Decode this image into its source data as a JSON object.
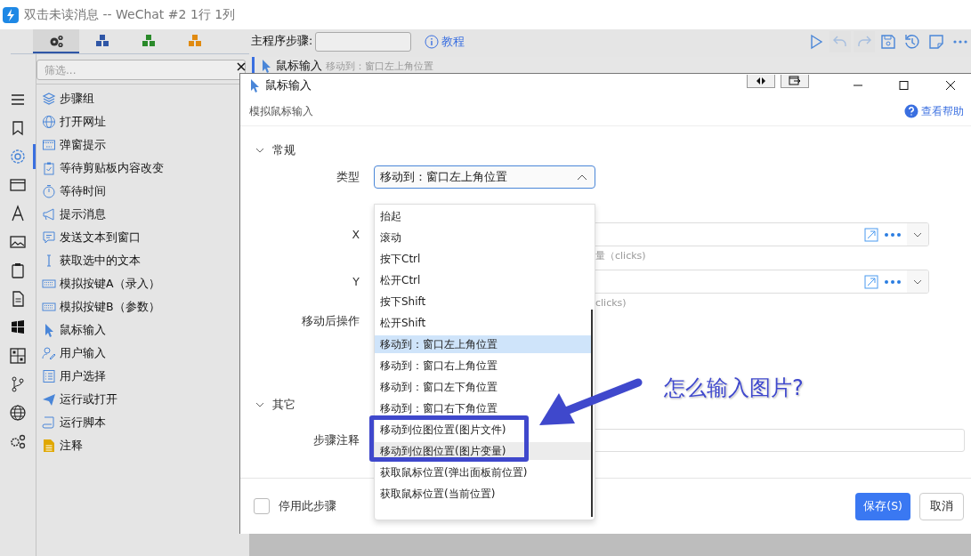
{
  "window": {
    "title": "双击未读消息 -- WeChat #2 1行 1列"
  },
  "palette_tabs": [
    {
      "selected": true,
      "color": "#333333"
    },
    {
      "selected": false,
      "color": "#2f56a6"
    },
    {
      "selected": false,
      "color": "#2a8a2a"
    },
    {
      "selected": false,
      "color": "#e08a10"
    }
  ],
  "filter": {
    "placeholder": "筛选..."
  },
  "rail": [
    {
      "kind": "menu",
      "selected": false
    },
    {
      "kind": "bookmark",
      "selected": false
    },
    {
      "kind": "gear",
      "selected": true
    },
    {
      "kind": "window",
      "selected": false
    },
    {
      "kind": "font",
      "selected": false
    },
    {
      "kind": "image",
      "selected": false
    },
    {
      "kind": "clipboard",
      "selected": false
    },
    {
      "kind": "document",
      "selected": false
    },
    {
      "kind": "panes",
      "selected": false
    },
    {
      "kind": "grid",
      "selected": false
    },
    {
      "kind": "branch",
      "selected": false
    },
    {
      "kind": "globe",
      "selected": false
    },
    {
      "kind": "gears",
      "selected": false
    }
  ],
  "actions": [
    {
      "label": "步骤组",
      "kind": "layers"
    },
    {
      "label": "打开网址",
      "kind": "globe"
    },
    {
      "label": "弹窗提示",
      "kind": "popup"
    },
    {
      "label": "等待剪贴板内容改变",
      "kind": "clipboard"
    },
    {
      "label": "等待时间",
      "kind": "stopwatch"
    },
    {
      "label": "提示消息",
      "kind": "megaphone"
    },
    {
      "label": "发送文本到窗口",
      "kind": "chat"
    },
    {
      "label": "获取选中的文本",
      "kind": "cursor"
    },
    {
      "label": "模拟按键A（录入）",
      "kind": "keyboard"
    },
    {
      "label": "模拟按键B（参数）",
      "kind": "keyboard"
    },
    {
      "label": "鼠标输入",
      "kind": "pointer"
    },
    {
      "label": "用户输入",
      "kind": "user"
    },
    {
      "label": "用户选择",
      "kind": "list"
    },
    {
      "label": "运行或打开",
      "kind": "plane"
    },
    {
      "label": "运行脚本",
      "kind": "scroll"
    },
    {
      "label": "注释",
      "kind": "note"
    }
  ],
  "toolbar": {
    "label": "主程序步骤:",
    "tutorial": "教程",
    "buttons": [
      {
        "kind": "run",
        "disabled": false
      },
      {
        "kind": "undo",
        "disabled": true
      },
      {
        "kind": "redo",
        "disabled": true
      },
      {
        "kind": "save",
        "disabled": false
      },
      {
        "kind": "history",
        "disabled": false
      },
      {
        "kind": "note",
        "disabled": false
      },
      {
        "kind": "more",
        "disabled": false
      }
    ]
  },
  "step": {
    "title": "鼠标输入",
    "detail": "移动到：窗口左上角位置"
  },
  "dialog": {
    "title": "鼠标输入",
    "subtitle": "模拟鼠标输入",
    "help": "查看帮助",
    "general": {
      "title": "常规",
      "expanded": true,
      "type_label": "类型",
      "type_value": "移动到：窗口左上角位置",
      "x_label": "X",
      "x_hint": "量（clicks)",
      "y_label": "Y",
      "y_hint": "clicks)",
      "after_label": "移动后操作"
    },
    "other": {
      "title": "其它",
      "expanded": true,
      "note_label": "步骤注释"
    },
    "disable_step": {
      "label": "停用此步骤",
      "checked": false
    },
    "save": "保存(S)",
    "cancel": "取消"
  },
  "dropdown": [
    {
      "label": "抬起",
      "selected": false,
      "highlighted": false
    },
    {
      "label": "滚动",
      "selected": false,
      "highlighted": false
    },
    {
      "label": "按下Ctrl",
      "selected": false,
      "highlighted": false
    },
    {
      "label": "松开Ctrl",
      "selected": false,
      "highlighted": false
    },
    {
      "label": "按下Shift",
      "selected": false,
      "highlighted": false
    },
    {
      "label": "松开Shift",
      "selected": false,
      "highlighted": false
    },
    {
      "label": "移动到：窗口左上角位置",
      "selected": true,
      "highlighted": false
    },
    {
      "label": "移动到：窗口右上角位置",
      "selected": false,
      "highlighted": false
    },
    {
      "label": "移动到：窗口左下角位置",
      "selected": false,
      "highlighted": false
    },
    {
      "label": "移动到：窗口右下角位置",
      "selected": false,
      "highlighted": false
    },
    {
      "label": "移动到位图位置(图片文件)",
      "selected": false,
      "highlighted": false
    },
    {
      "label": "移动到位图位置(图片变量)",
      "selected": false,
      "highlighted": true
    },
    {
      "label": "获取鼠标位置(弹出面板前位置)",
      "selected": false,
      "highlighted": false
    },
    {
      "label": "获取鼠标位置(当前位置)",
      "selected": false,
      "highlighted": false
    }
  ],
  "annotation": {
    "text": "怎么输入图片?"
  }
}
